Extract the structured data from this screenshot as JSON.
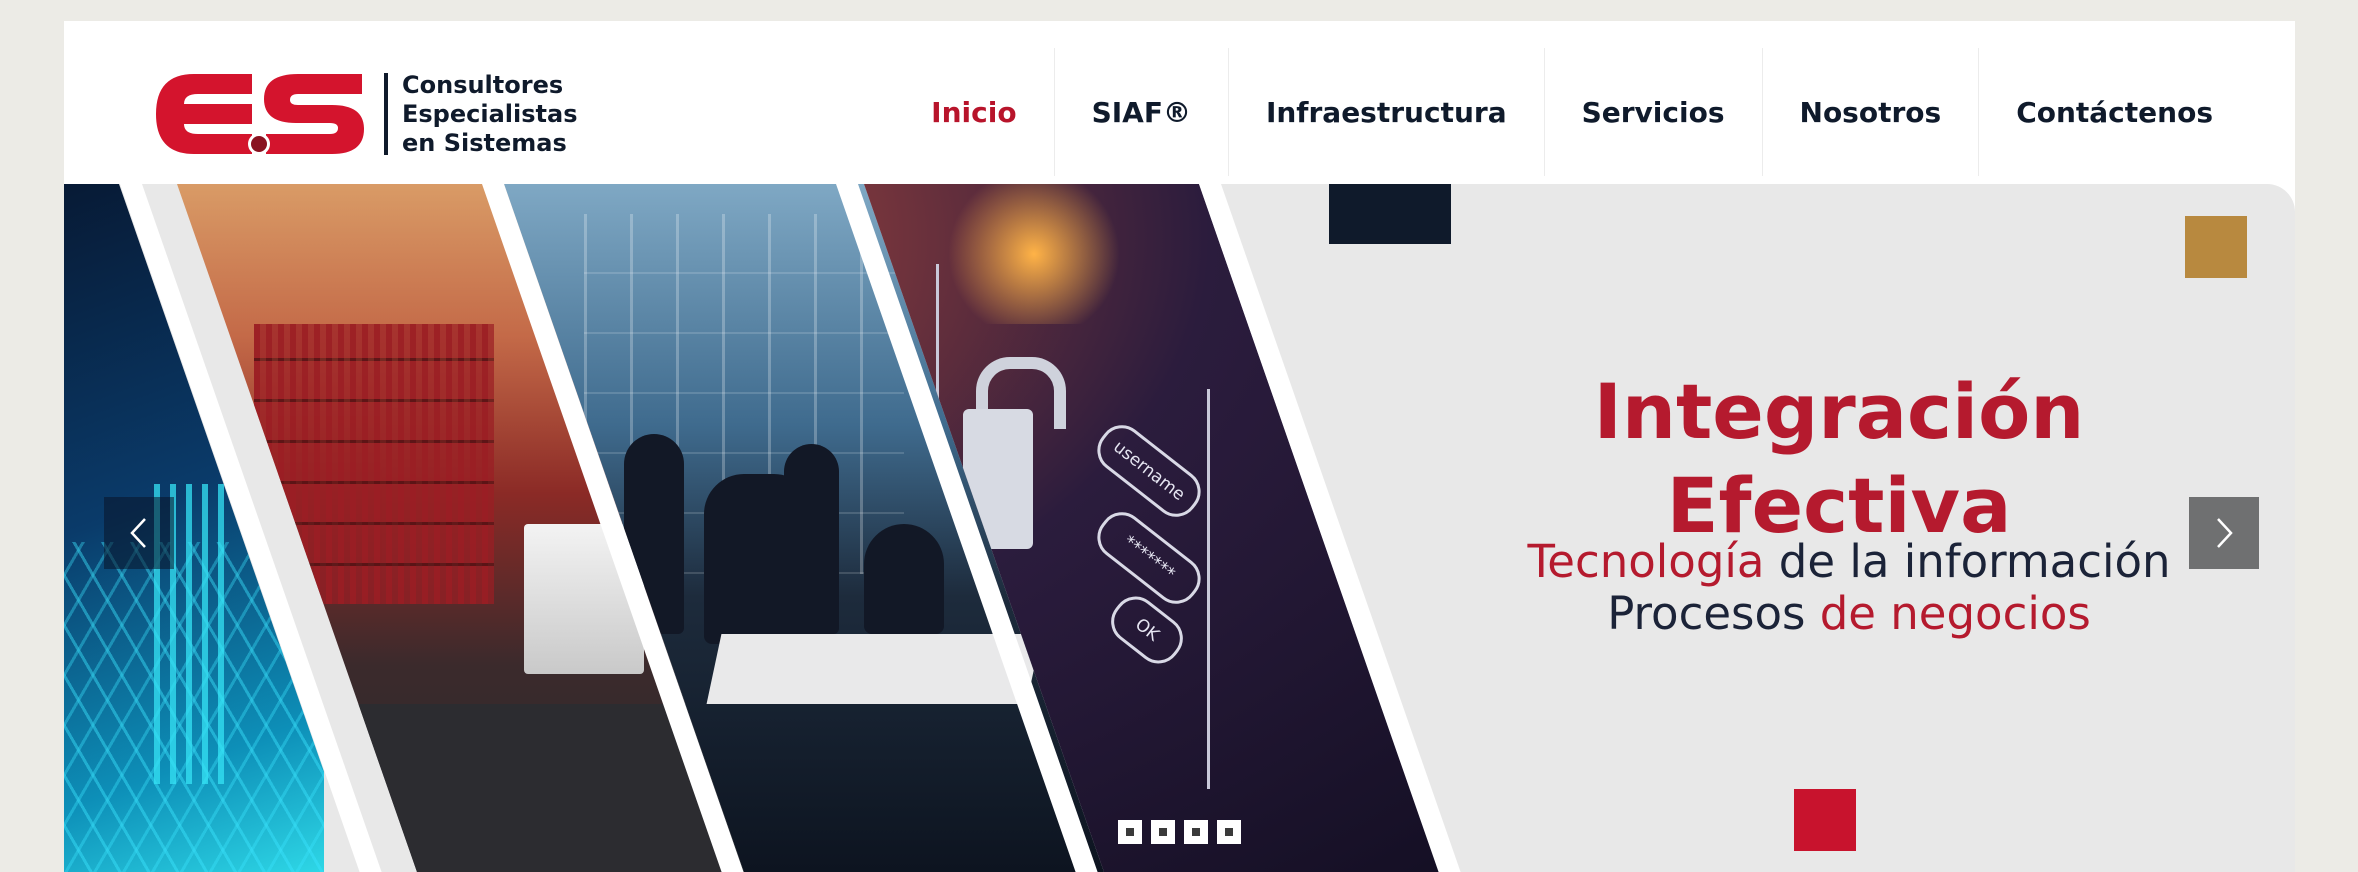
{
  "logo": {
    "mark_text": "E.S",
    "lines": [
      "Consultores",
      "Especialistas",
      "en Sistemas"
    ]
  },
  "nav": {
    "items": [
      {
        "label": "Inicio",
        "active": true
      },
      {
        "label": "SIAF®",
        "active": false
      },
      {
        "label": "Infraestructura",
        "active": false
      },
      {
        "label": "Servicios",
        "active": false
      },
      {
        "label": "Nosotros",
        "active": false
      },
      {
        "label": "Contáctenos",
        "active": false
      }
    ]
  },
  "hero": {
    "title_line1": "Integración",
    "title_line2": "Efectiva",
    "sub_line1_red": "Tecnología",
    "sub_line1_rest": " de la información",
    "sub_line2_dark": "Procesos ",
    "sub_line2_red": "de negocios",
    "login_fields": [
      "username",
      "*******",
      "OK"
    ],
    "slide_count": 4
  },
  "icons": {
    "prev": "chevron-left-icon",
    "next": "chevron-right-icon",
    "lock": "padlock-icon"
  },
  "colors": {
    "brand_red": "#c8132d",
    "navy": "#0f1a2b",
    "gold": "#b8893f",
    "hero_bg": "#e8e8e8"
  }
}
